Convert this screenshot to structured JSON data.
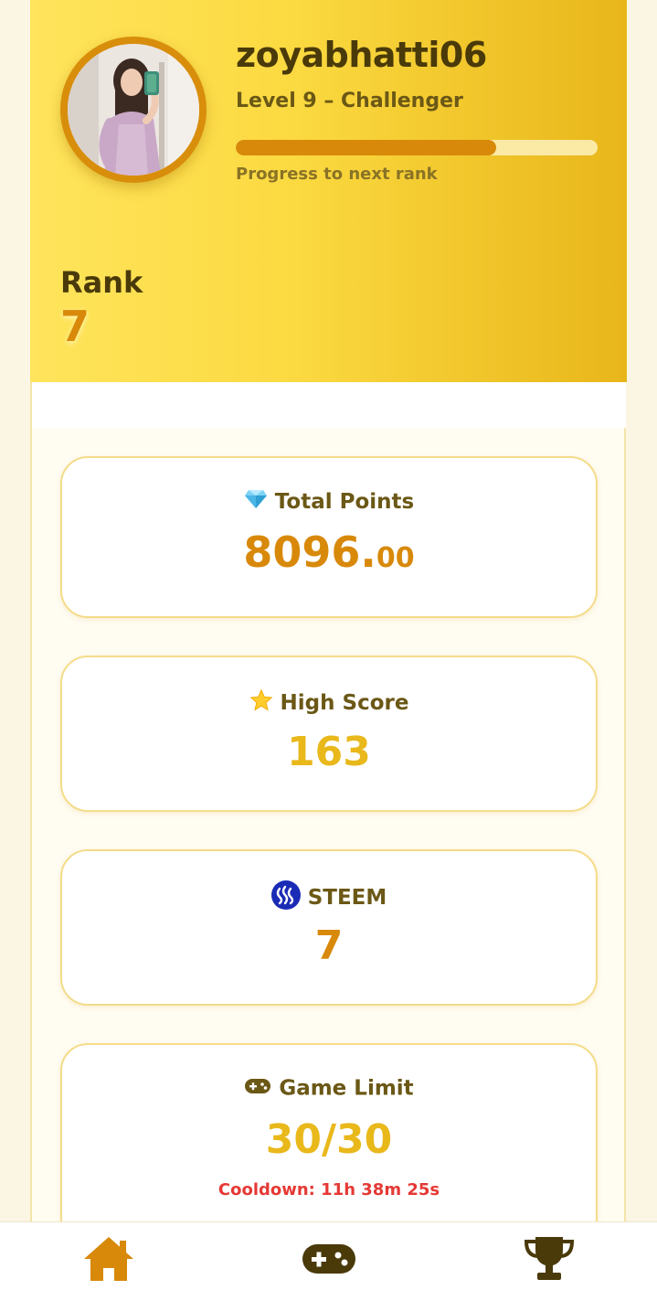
{
  "profile": {
    "username": "zoyabhatti06",
    "level_text": "Level 9 – Challenger",
    "progress_label": "Progress to next rank",
    "progress_fraction": 0.72
  },
  "rank": {
    "label": "Rank",
    "value": "7"
  },
  "stats": {
    "total_points": {
      "icon": "gem-icon",
      "label": "Total Points",
      "value_main": "8096.",
      "value_decimal": "00"
    },
    "high_score": {
      "icon": "star-icon",
      "label": "High Score",
      "value": "163"
    },
    "steem": {
      "icon": "steem-icon",
      "label": "STEEM",
      "value": "7"
    },
    "game_limit": {
      "icon": "gamepad-icon",
      "label": "Game Limit",
      "value": "30/30",
      "cooldown": "Cooldown: 11h 38m 25s"
    }
  },
  "nav": {
    "items": [
      {
        "icon": "home-icon",
        "color": "#d8890a"
      },
      {
        "icon": "gamepad-icon",
        "color": "#4a3a0a"
      },
      {
        "icon": "trophy-icon",
        "color": "#4a3a0a"
      }
    ]
  },
  "colors": {
    "accent_orange": "#d8890a",
    "accent_yellow": "#e9b81b",
    "dark_brown": "#4a3a0a",
    "cooldown_red": "#e53935",
    "steem_blue": "#1a2bb5"
  }
}
